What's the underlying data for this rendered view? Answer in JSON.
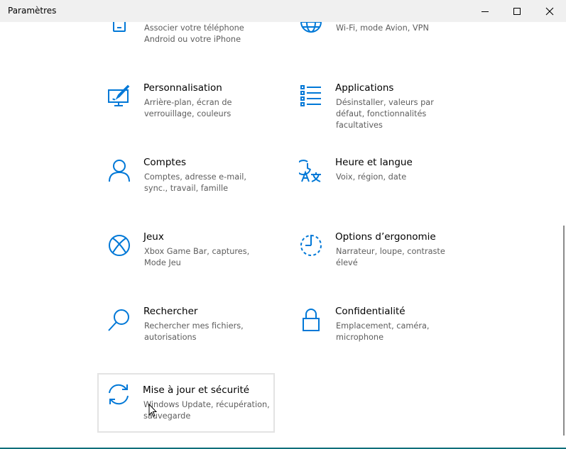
{
  "window": {
    "title": "Paramètres",
    "accent_color": "#0078d7",
    "controls": {
      "minimize": "minimize-icon",
      "maximize": "maximize-icon",
      "close": "close-icon"
    }
  },
  "tiles": [
    {
      "name": "",
      "description": "Associer votre téléphone Android ou votre iPhone",
      "icon": "phone-icon"
    },
    {
      "name": "",
      "description": "Wi-Fi, mode Avion, VPN",
      "icon": "globe-icon"
    },
    {
      "name": "Personnalisation",
      "description": "Arrière-plan, écran de verrouillage, couleurs",
      "icon": "personalization-icon"
    },
    {
      "name": "Applications",
      "description": "Désinstaller, valeurs par défaut, fonctionnalités facultatives",
      "icon": "apps-list-icon"
    },
    {
      "name": "Comptes",
      "description": "Comptes, adresse e-mail, sync., travail, famille",
      "icon": "person-icon"
    },
    {
      "name": "Heure et langue",
      "description": "Voix, région, date",
      "icon": "time-language-icon"
    },
    {
      "name": "Jeux",
      "description": "Xbox Game Bar, captures, Mode Jeu",
      "icon": "xbox-icon"
    },
    {
      "name": "Options d’ergonomie",
      "description": "Narrateur, loupe, contraste élevé",
      "icon": "ease-of-access-icon"
    },
    {
      "name": "Rechercher",
      "description": "Rechercher mes fichiers, autorisations",
      "icon": "search-icon"
    },
    {
      "name": "Confidentialité",
      "description": "Emplacement, caméra, microphone",
      "icon": "lock-icon"
    },
    {
      "name": "Mise à jour et sécurité",
      "description": "Windows Update, récupération, sauvegarde",
      "icon": "update-icon"
    }
  ]
}
